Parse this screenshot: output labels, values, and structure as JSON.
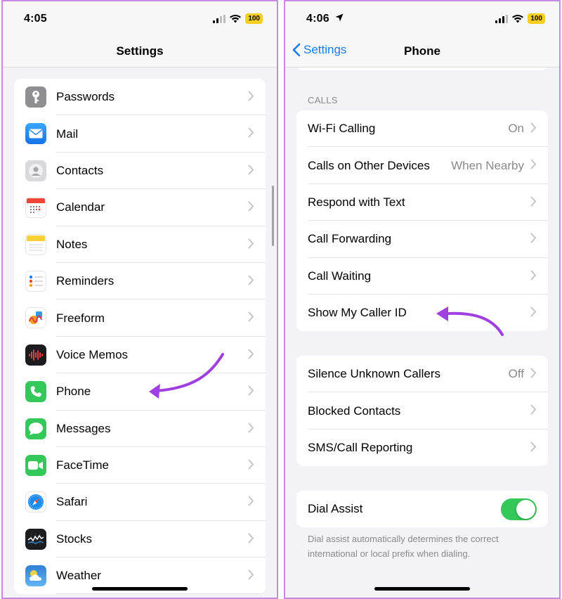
{
  "left": {
    "status": {
      "time": "4:05",
      "battery": "100"
    },
    "title": "Settings",
    "items": [
      {
        "label": "Passwords",
        "icon": "key-icon",
        "color": "#8e8e93"
      },
      {
        "label": "Mail",
        "icon": "mail-icon",
        "color": "#1e8cf0"
      },
      {
        "label": "Contacts",
        "icon": "contacts-icon",
        "color": "#c9c9cc"
      },
      {
        "label": "Calendar",
        "icon": "calendar-icon",
        "color": "#ffffff"
      },
      {
        "label": "Notes",
        "icon": "notes-icon",
        "color": "#ffffff"
      },
      {
        "label": "Reminders",
        "icon": "reminders-icon",
        "color": "#ffffff"
      },
      {
        "label": "Freeform",
        "icon": "freeform-icon",
        "color": "#ffffff"
      },
      {
        "label": "Voice Memos",
        "icon": "voice-memos-icon",
        "color": "#1c1c1e"
      },
      {
        "label": "Phone",
        "icon": "phone-icon",
        "color": "#34c759"
      },
      {
        "label": "Messages",
        "icon": "messages-icon",
        "color": "#34c759"
      },
      {
        "label": "FaceTime",
        "icon": "facetime-icon",
        "color": "#34c759"
      },
      {
        "label": "Safari",
        "icon": "safari-icon",
        "color": "#1a7cf5"
      },
      {
        "label": "Stocks",
        "icon": "stocks-icon",
        "color": "#1c1c1e"
      },
      {
        "label": "Weather",
        "icon": "weather-icon",
        "color": "#2f7fd4"
      }
    ]
  },
  "right": {
    "status": {
      "time": "4:06",
      "battery": "100"
    },
    "back_label": "Settings",
    "title": "Phone",
    "calls_header": "CALLS",
    "calls": [
      {
        "label": "Wi-Fi Calling",
        "value": "On"
      },
      {
        "label": "Calls on Other Devices",
        "value": "When Nearby"
      },
      {
        "label": "Respond with Text",
        "value": ""
      },
      {
        "label": "Call Forwarding",
        "value": ""
      },
      {
        "label": "Call Waiting",
        "value": ""
      },
      {
        "label": "Show My Caller ID",
        "value": ""
      }
    ],
    "blocking": [
      {
        "label": "Silence Unknown Callers",
        "value": "Off"
      },
      {
        "label": "Blocked Contacts",
        "value": ""
      },
      {
        "label": "SMS/Call Reporting",
        "value": ""
      }
    ],
    "dial_assist": {
      "label": "Dial Assist",
      "enabled": true,
      "description": "Dial assist automatically determines the correct international or local prefix when dialing."
    }
  },
  "colors": {
    "accent": "#1a7cf5",
    "annotation": "#a040e0",
    "toggle_on": "#34c759",
    "frame": "#c78be0"
  }
}
